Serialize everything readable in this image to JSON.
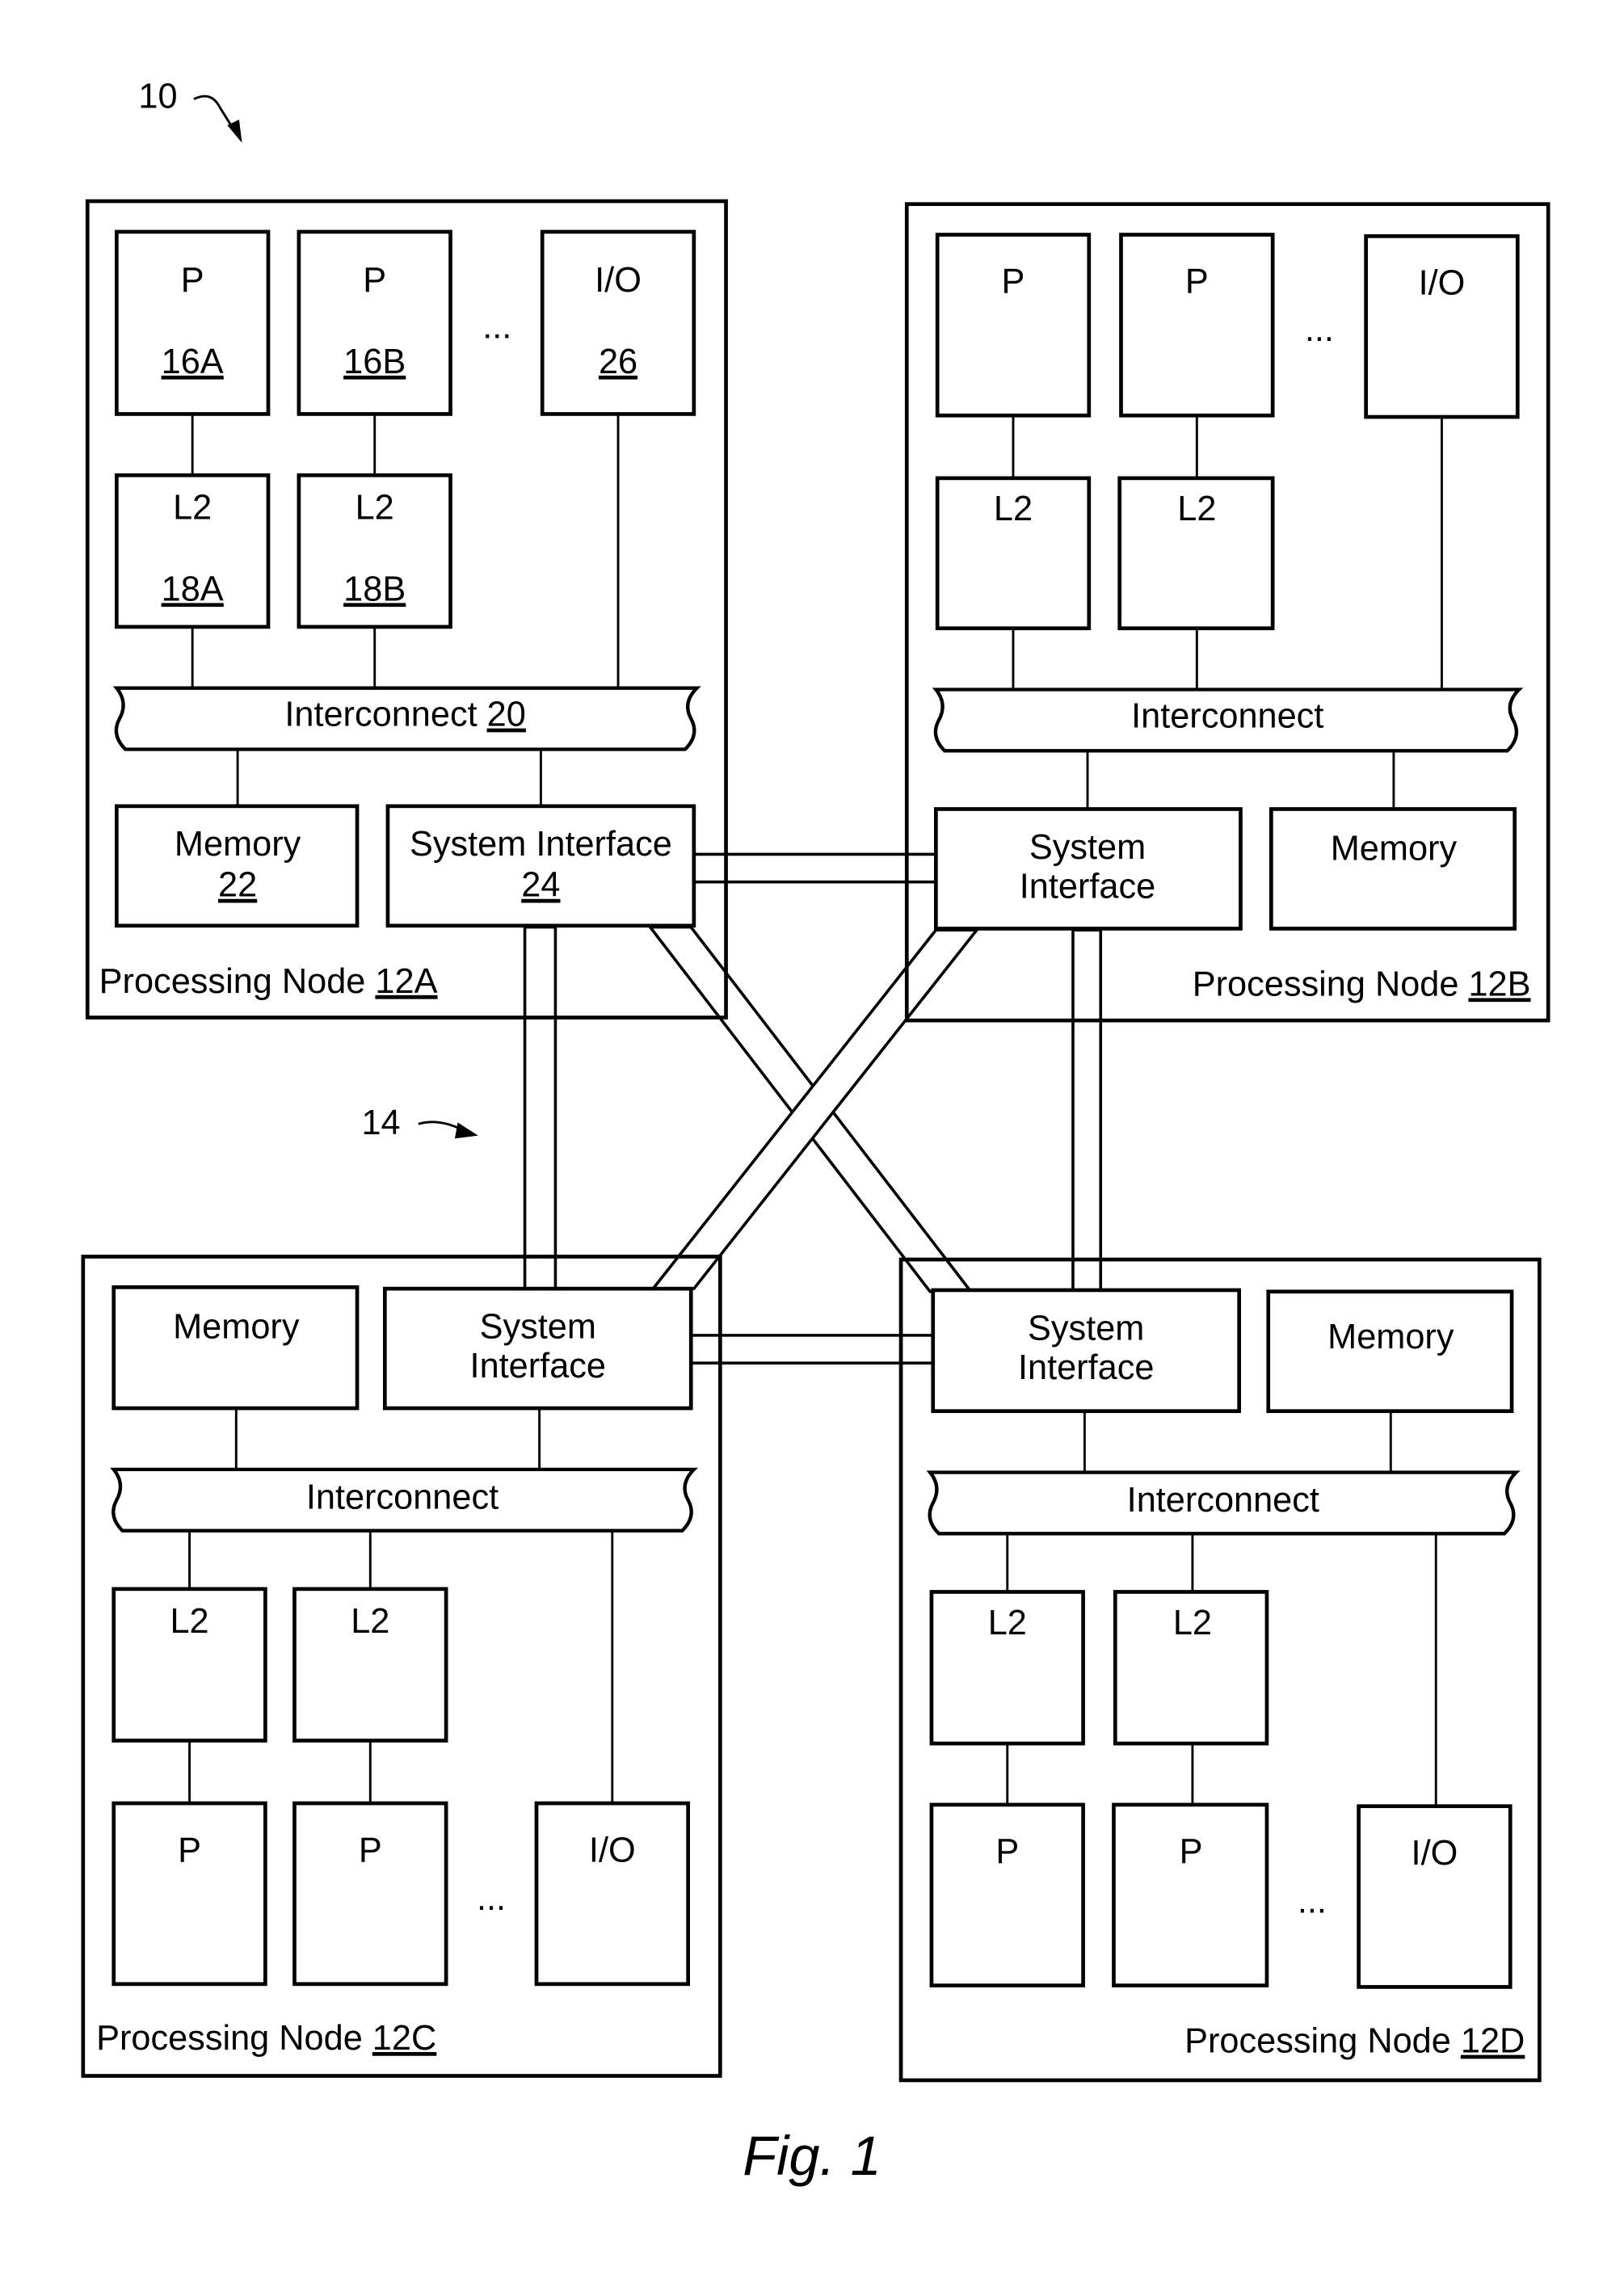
{
  "figure": {
    "caption": "Fig. 1",
    "system_ref": "10",
    "network_ref": "14"
  },
  "nodes": {
    "a": {
      "label": "Processing Node ",
      "ref": "12A",
      "proc1": {
        "name": "P",
        "ref": "16A"
      },
      "proc2": {
        "name": "P",
        "ref": "16B"
      },
      "io": {
        "name": "I/O",
        "ref": "26"
      },
      "l2_1": {
        "name": "L2",
        "ref": "18A"
      },
      "l2_2": {
        "name": "L2",
        "ref": "18B"
      },
      "interconnect": {
        "name": "Interconnect ",
        "ref": "20"
      },
      "memory": {
        "name": "Memory",
        "ref": "22"
      },
      "sysif": {
        "name": "System Interface",
        "ref": "24"
      },
      "ellipsis": "..."
    },
    "b": {
      "label": "Processing Node ",
      "ref": "12B",
      "proc1": {
        "name": "P"
      },
      "proc2": {
        "name": "P"
      },
      "io": {
        "name": "I/O"
      },
      "l2_1": {
        "name": "L2"
      },
      "l2_2": {
        "name": "L2"
      },
      "interconnect": {
        "name": "Interconnect"
      },
      "memory": {
        "name": "Memory"
      },
      "sysif": {
        "line1": "System",
        "line2": "Interface"
      },
      "ellipsis": "..."
    },
    "c": {
      "label": "Processing Node ",
      "ref": "12C",
      "proc1": {
        "name": "P"
      },
      "proc2": {
        "name": "P"
      },
      "io": {
        "name": "I/O"
      },
      "l2_1": {
        "name": "L2"
      },
      "l2_2": {
        "name": "L2"
      },
      "interconnect": {
        "name": "Interconnect"
      },
      "memory": {
        "name": "Memory"
      },
      "sysif": {
        "line1": "System",
        "line2": "Interface"
      },
      "ellipsis": "..."
    },
    "d": {
      "label": "Processing Node ",
      "ref": "12D",
      "proc1": {
        "name": "P"
      },
      "proc2": {
        "name": "P"
      },
      "io": {
        "name": "I/O"
      },
      "l2_1": {
        "name": "L2"
      },
      "l2_2": {
        "name": "L2"
      },
      "interconnect": {
        "name": "Interconnect"
      },
      "memory": {
        "name": "Memory"
      },
      "sysif": {
        "line1": "System",
        "line2": "Interface"
      },
      "ellipsis": "..."
    }
  }
}
